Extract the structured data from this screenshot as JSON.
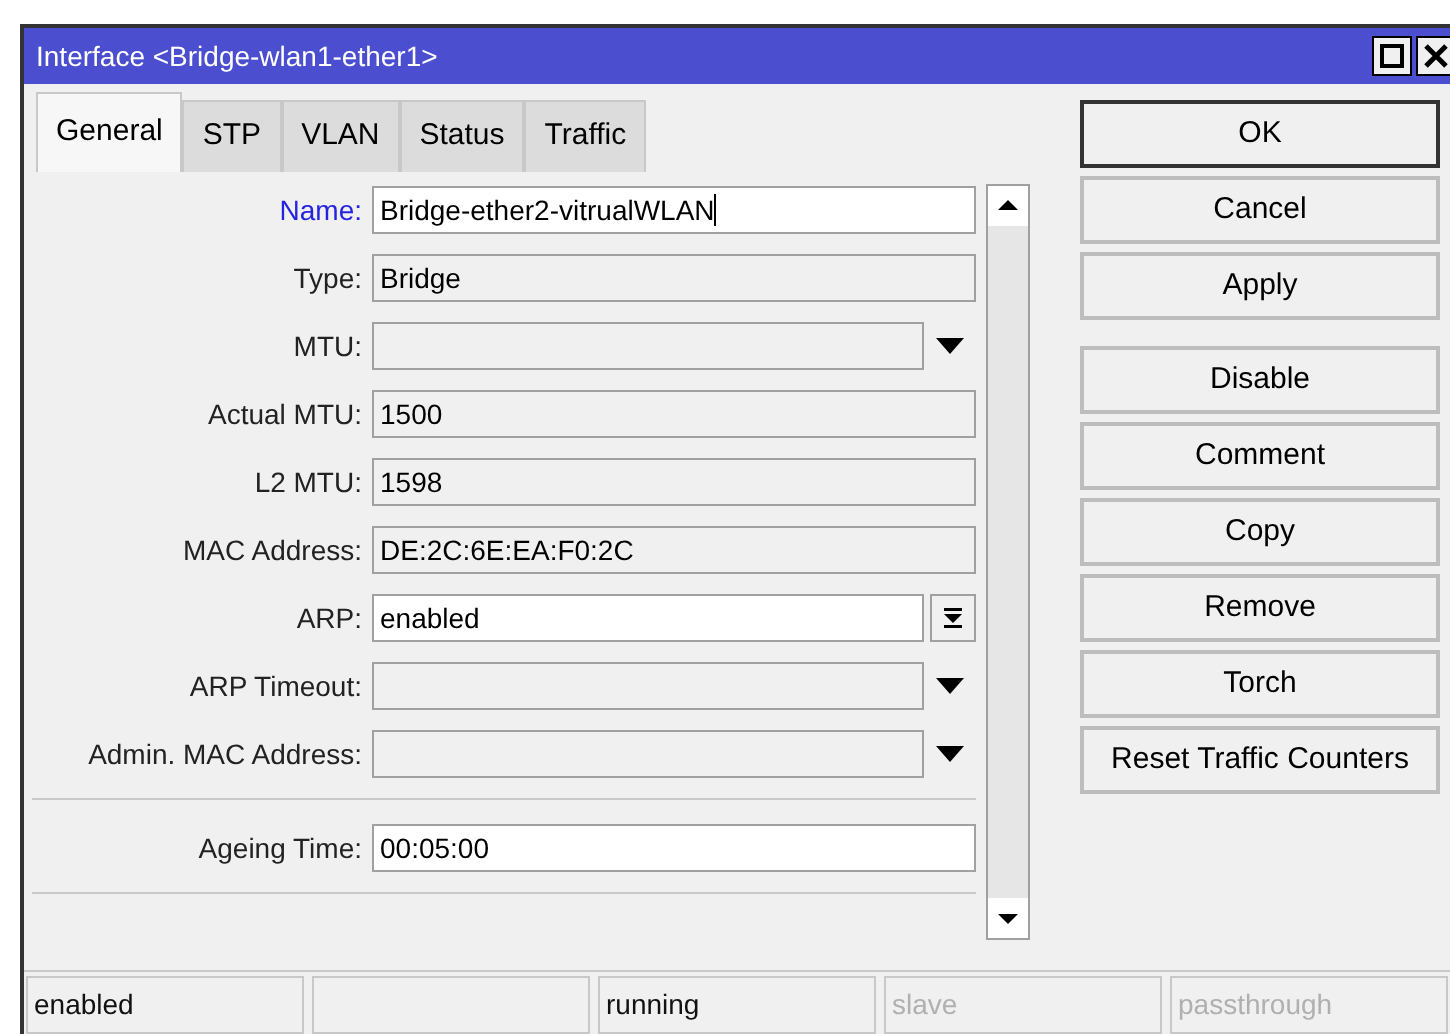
{
  "window": {
    "title": "Interface <Bridge-wlan1-ether1>"
  },
  "tabs": [
    {
      "label": "General",
      "selected": true
    },
    {
      "label": "STP",
      "selected": false
    },
    {
      "label": "VLAN",
      "selected": false
    },
    {
      "label": "Status",
      "selected": false
    },
    {
      "label": "Traffic",
      "selected": false
    }
  ],
  "field_groups": [
    [
      {
        "label": "Name:",
        "value": "Bridge-ether2-vitrualWLAN",
        "kind": "input",
        "focused": true
      },
      {
        "label": "Type:",
        "value": "Bridge",
        "kind": "readonly",
        "focused": false
      },
      {
        "label": "MTU:",
        "kind": "dropdown",
        "focused": false
      },
      {
        "label": "Actual MTU:",
        "value": "1500",
        "kind": "readonly",
        "focused": false
      },
      {
        "label": "L2 MTU:",
        "value": "1598",
        "kind": "readonly",
        "focused": false
      },
      {
        "label": "MAC Address:",
        "value": "DE:2C:6E:EA:F0:2C",
        "kind": "readonly",
        "focused": false
      },
      {
        "label": "ARP:",
        "value": "enabled",
        "kind": "select",
        "focused": false
      },
      {
        "label": "ARP Timeout:",
        "kind": "dropdown",
        "focused": false
      },
      {
        "label": "Admin. MAC Address:",
        "kind": "dropdown",
        "focused": false
      }
    ],
    [
      {
        "label": "Ageing Time:",
        "value": "00:05:00",
        "kind": "input",
        "focused": false
      }
    ]
  ],
  "button_groups": [
    [
      "OK",
      "Cancel",
      "Apply"
    ],
    [
      "Disable",
      "Comment",
      "Copy",
      "Remove",
      "Torch",
      "Reset Traffic Counters"
    ]
  ],
  "status_bar": [
    {
      "text": "enabled",
      "disabled": false
    },
    {
      "disabled": false
    },
    {
      "text": "running",
      "disabled": false
    },
    {
      "text": "slave",
      "disabled": true
    },
    {
      "text": "passthrough",
      "disabled": true
    }
  ]
}
